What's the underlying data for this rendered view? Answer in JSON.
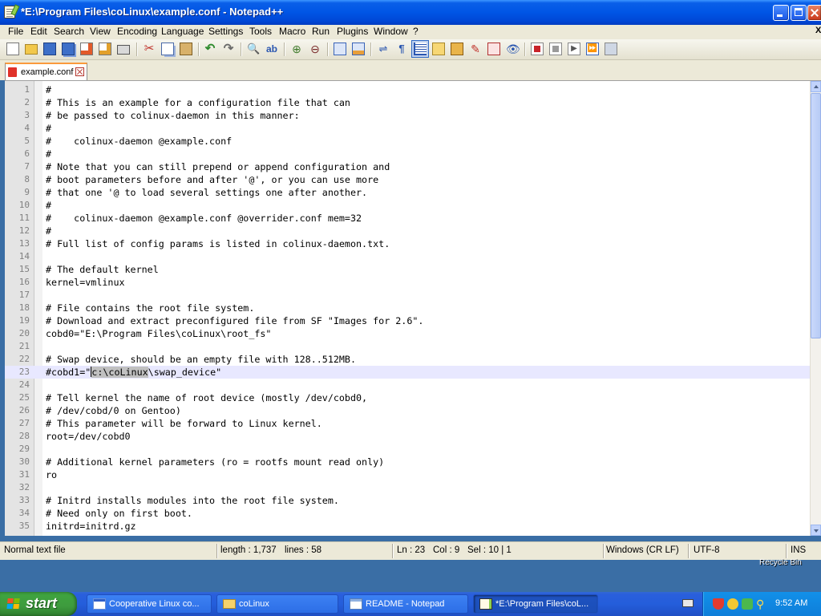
{
  "window": {
    "title": "*E:\\Program Files\\coLinux\\example.conf - Notepad++"
  },
  "menu": [
    "File",
    "Edit",
    "Search",
    "View",
    "Encoding",
    "Language",
    "Settings",
    "Tools",
    "Macro",
    "Run",
    "Plugins",
    "Window",
    "?"
  ],
  "menu_close_glyph": "X",
  "tab": {
    "label": "example.conf"
  },
  "editor": {
    "current_line": 23,
    "lines": [
      "#",
      "# This is an example for a configuration file that can",
      "# be passed to colinux-daemon in this manner:",
      "#",
      "#    colinux-daemon @example.conf",
      "#",
      "# Note that you can still prepend or append configuration and",
      "# boot parameters before and after '@', or you can use more",
      "# that one '@ to load several settings one after another.",
      "#",
      "#    colinux-daemon @example.conf @overrider.conf mem=32",
      "#",
      "# Full list of config params is listed in colinux-daemon.txt.",
      "",
      "# The default kernel",
      "kernel=vmlinux",
      "",
      "# File contains the root file system.",
      "# Download and extract preconfigured file from SF \"Images for 2.6\".",
      "cobd0=\"E:\\Program Files\\coLinux\\root_fs\"",
      "",
      "# Swap device, should be an empty file with 128..512MB.",
      "#cobd1=\"c:\\coLinux\\swap_device\"",
      "",
      "# Tell kernel the name of root device (mostly /dev/cobd0,",
      "# /dev/cobd/0 on Gentoo)",
      "# This parameter will be forward to Linux kernel.",
      "root=/dev/cobd0",
      "",
      "# Additional kernel parameters (ro = rootfs mount read only)",
      "ro",
      "",
      "# Initrd installs modules into the root file system.",
      "# Need only on first boot.",
      "initrd=initrd.gz"
    ],
    "line_23_parts": {
      "before": "#cobd1=\"",
      "selected": "c:\\coLinux",
      "after": "\\swap_device\""
    }
  },
  "status": {
    "file_type": "Normal text file",
    "length": "length : 1,737",
    "lines": "lines : 58",
    "ln": "Ln : 23",
    "col": "Col : 9",
    "sel": "Sel : 10 | 1",
    "eol": "Windows (CR LF)",
    "encoding": "UTF-8",
    "mode": "INS"
  },
  "desktop": {
    "recycle_label": "Recycle Bin"
  },
  "taskbar": {
    "start_label": "start",
    "tasks": [
      {
        "label": "Cooperative Linux co...",
        "icon": "ie-window-icon"
      },
      {
        "label": "coLinux",
        "icon": "folder-icon"
      },
      {
        "label": "README - Notepad",
        "icon": "notepad-icon"
      },
      {
        "label": "*E:\\Program Files\\coL...",
        "icon": "notepad-plus-plus-icon"
      }
    ],
    "clock": "9:52 AM"
  },
  "colors": {
    "title_blue": "#0055e5",
    "start_green": "#3e9b3e",
    "tray_blue": "#0e7ed9",
    "current_line": "#e8e8ff",
    "selection": "#c0c0c0"
  }
}
